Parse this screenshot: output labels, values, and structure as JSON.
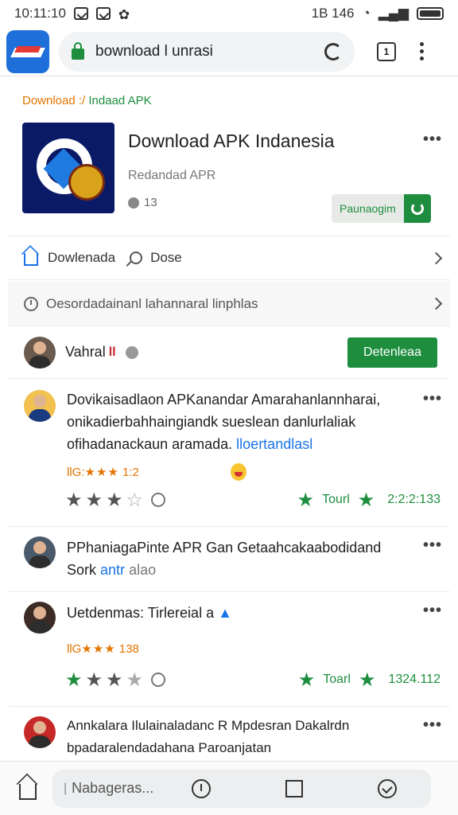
{
  "status_bar": {
    "time": "10:11:10",
    "right_label": "1B 146"
  },
  "browser": {
    "url": "bownload l unrasi",
    "tab_count": "1"
  },
  "breadcrumb": {
    "part_a": "Download :/",
    "part_b": "Indaad APK"
  },
  "app": {
    "title": "Download APK Indanesia",
    "subtitle": "Redandad APR",
    "rating_count": "13",
    "install_label": "Paunaogim"
  },
  "links": {
    "first": "Dowlenada",
    "second": "Dose"
  },
  "description": "Oesordadainanl lahannaral linphlas",
  "user": {
    "name": "Vahral",
    "flag": "ll",
    "download_label": "Detenleaa"
  },
  "reviews": [
    {
      "text": "Dovikaisadlaon APKanandar Amarahanlannharai, onikadierbahhaingiandk sueslean danlurlaliak ofihadanackaun aramada.",
      "link": "lloertandlasl",
      "meta_stars": "★★★",
      "meta_prefix": "llG:",
      "meta_count": "1:2",
      "tool_label": "Tourl",
      "tool_count": "2:2:2:133"
    },
    {
      "text": "PPhaniagaPinte APR Gan Getaahcakaabodidand",
      "line2_a": "Sork",
      "line2_link": "antr",
      "line2_b": "alao"
    },
    {
      "text": "Uetdenmas: Tirlereial a",
      "meta_stars": "★★★",
      "meta_prefix": "llG",
      "meta_count": "138",
      "tool_label": "Toarl",
      "tool_count": "1324.112"
    },
    {
      "text": "Annkalara Ilulainaladanc R Mpdesran Dakalrdn bpadaralendadahana Paroanjatan"
    }
  ],
  "bottom_nav": {
    "search_placeholder": "Nabageras..."
  }
}
